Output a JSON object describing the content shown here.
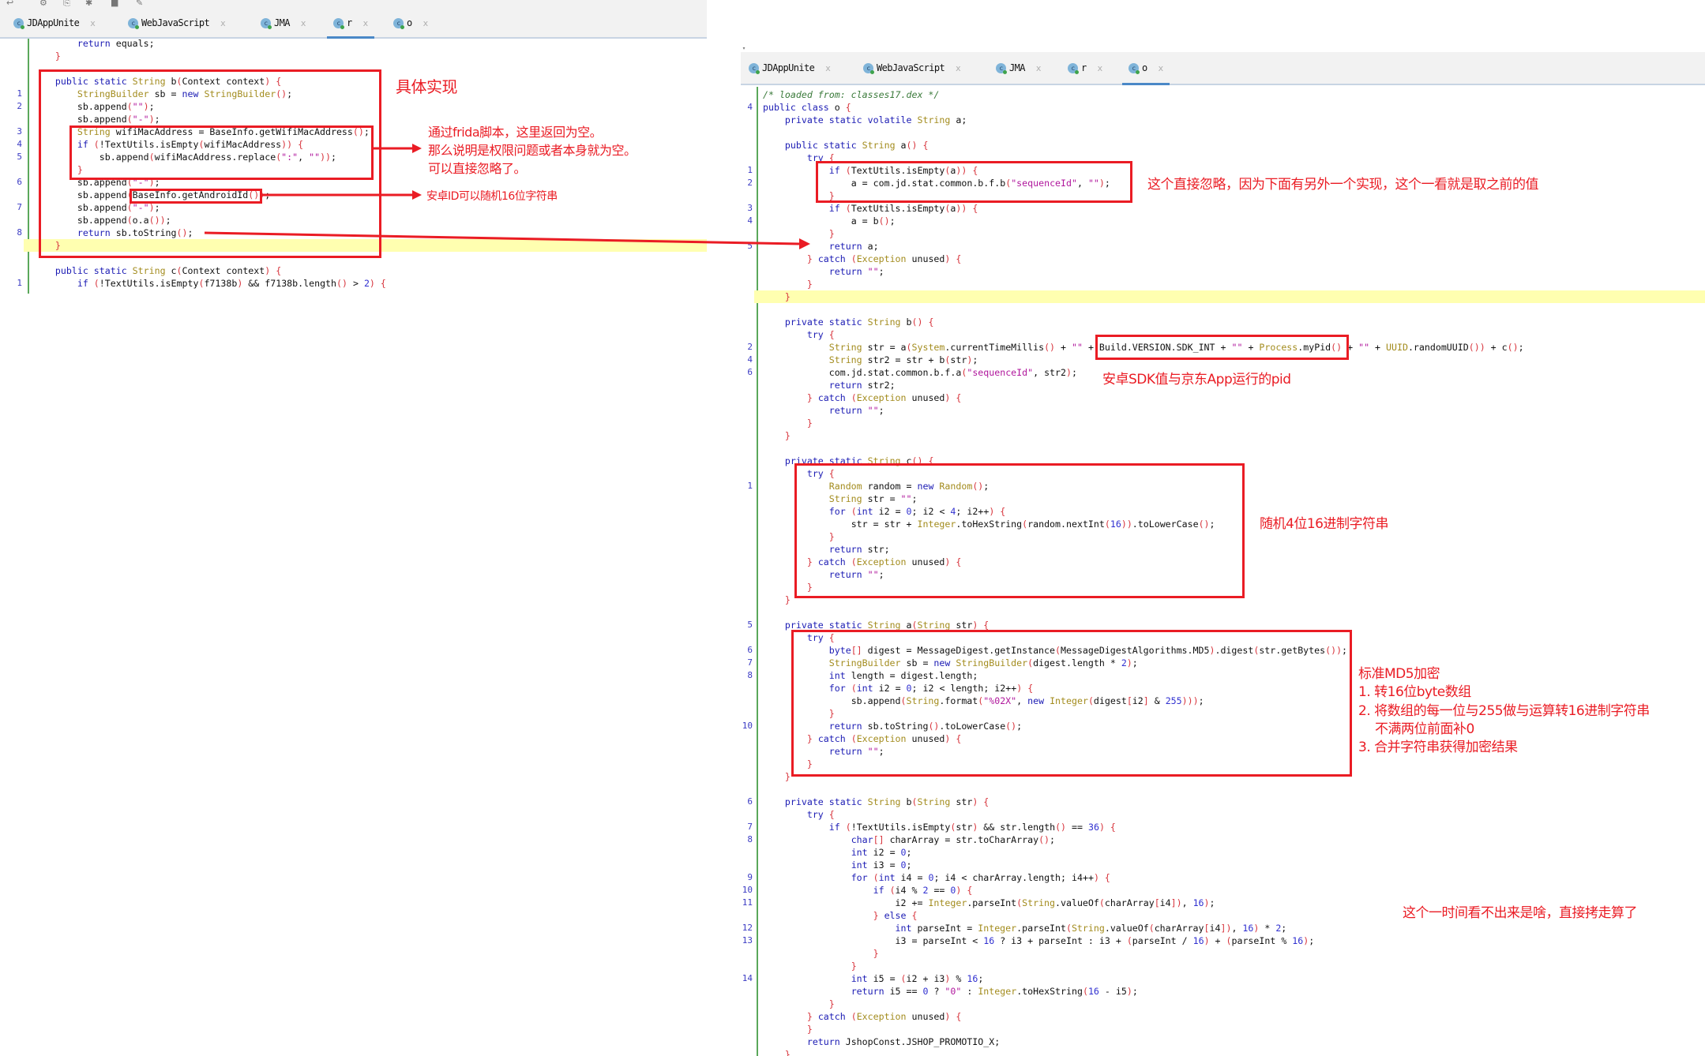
{
  "left_editor": {
    "tabs": [
      {
        "label": "JDAppUnite",
        "active": false
      },
      {
        "label": "WebJavaScript",
        "active": false
      },
      {
        "label": "JMA",
        "active": false
      },
      {
        "label": "r",
        "active": true
      },
      {
        "label": "o",
        "active": false
      }
    ],
    "tab_icon": "c",
    "close_glyph": "x",
    "highlighted_line": 16,
    "lines": [
      {
        "n": "",
        "t": "        return equals;"
      },
      {
        "n": "",
        "t": "    }"
      },
      {
        "n": "",
        "t": ""
      },
      {
        "n": "",
        "t": "    public static String b(Context context) {"
      },
      {
        "n": "1",
        "t": "        StringBuilder sb = new StringBuilder();"
      },
      {
        "n": "2",
        "t": "        sb.append(\"\");"
      },
      {
        "n": "",
        "t": "        sb.append(\"-\");"
      },
      {
        "n": "3",
        "t": "        String wifiMacAddress = BaseInfo.getWifiMacAddress();"
      },
      {
        "n": "4",
        "t": "        if (!TextUtils.isEmpty(wifiMacAddress)) {"
      },
      {
        "n": "5",
        "t": "            sb.append(wifiMacAddress.replace(\":\", \"\"));"
      },
      {
        "n": "",
        "t": "        }"
      },
      {
        "n": "6",
        "t": "        sb.append(\"-\");"
      },
      {
        "n": "",
        "t": "        sb.append(BaseInfo.getAndroidId());"
      },
      {
        "n": "7",
        "t": "        sb.append(\"-\");"
      },
      {
        "n": "",
        "t": "        sb.append(o.a());"
      },
      {
        "n": "8",
        "t": "        return sb.toString();"
      },
      {
        "n": "",
        "t": "    }"
      },
      {
        "n": "",
        "t": ""
      },
      {
        "n": "",
        "t": "    public static String c(Context context) {"
      },
      {
        "n": "1",
        "t": "        if (!TextUtils.isEmpty(f7138b) && f7138b.length() > 2) {"
      }
    ]
  },
  "right_editor": {
    "tabs": [
      {
        "label": "JDAppUnite",
        "active": false
      },
      {
        "label": "WebJavaScript",
        "active": false
      },
      {
        "label": "JMA",
        "active": false
      },
      {
        "label": "r",
        "active": false
      },
      {
        "label": "o",
        "active": true
      }
    ],
    "highlighted_line": 16,
    "lines": [
      {
        "n": "",
        "t": "/* loaded from: classes17.dex */"
      },
      {
        "n": "4",
        "t": "public class o {"
      },
      {
        "n": "",
        "t": "    private static volatile String a;"
      },
      {
        "n": "",
        "t": ""
      },
      {
        "n": "",
        "t": "    public static String a() {"
      },
      {
        "n": "",
        "t": "        try {"
      },
      {
        "n": "1",
        "t": "            if (TextUtils.isEmpty(a)) {"
      },
      {
        "n": "2",
        "t": "                a = com.jd.stat.common.b.f.b(\"sequenceId\", \"\");"
      },
      {
        "n": "",
        "t": "            }"
      },
      {
        "n": "3",
        "t": "            if (TextUtils.isEmpty(a)) {"
      },
      {
        "n": "4",
        "t": "                a = b();"
      },
      {
        "n": "",
        "t": "            }"
      },
      {
        "n": "5",
        "t": "            return a;"
      },
      {
        "n": "",
        "t": "        } catch (Exception unused) {"
      },
      {
        "n": "",
        "t": "            return \"\";"
      },
      {
        "n": "",
        "t": "        }"
      },
      {
        "n": "",
        "t": "    }"
      },
      {
        "n": "",
        "t": ""
      },
      {
        "n": "",
        "t": "    private static String b() {"
      },
      {
        "n": "",
        "t": "        try {"
      },
      {
        "n": "2",
        "t": "            String str = a(System.currentTimeMillis() + \"\" + Build.VERSION.SDK_INT + \"\" + Process.myPid() + \"\" + UUID.randomUUID()) + c();"
      },
      {
        "n": "4",
        "t": "            String str2 = str + b(str);"
      },
      {
        "n": "6",
        "t": "            com.jd.stat.common.b.f.a(\"sequenceId\", str2);"
      },
      {
        "n": "",
        "t": "            return str2;"
      },
      {
        "n": "",
        "t": "        } catch (Exception unused) {"
      },
      {
        "n": "",
        "t": "            return \"\";"
      },
      {
        "n": "",
        "t": "        }"
      },
      {
        "n": "",
        "t": "    }"
      },
      {
        "n": "",
        "t": ""
      },
      {
        "n": "",
        "t": "    private static String c() {"
      },
      {
        "n": "",
        "t": "        try {"
      },
      {
        "n": "1",
        "t": "            Random random = new Random();"
      },
      {
        "n": "",
        "t": "            String str = \"\";"
      },
      {
        "n": "",
        "t": "            for (int i2 = 0; i2 < 4; i2++) {"
      },
      {
        "n": "",
        "t": "                str = str + Integer.toHexString(random.nextInt(16)).toLowerCase();"
      },
      {
        "n": "",
        "t": "            }"
      },
      {
        "n": "",
        "t": "            return str;"
      },
      {
        "n": "",
        "t": "        } catch (Exception unused) {"
      },
      {
        "n": "",
        "t": "            return \"\";"
      },
      {
        "n": "",
        "t": "        }"
      },
      {
        "n": "",
        "t": "    }"
      },
      {
        "n": "",
        "t": ""
      },
      {
        "n": "5",
        "t": "    private static String a(String str) {"
      },
      {
        "n": "",
        "t": "        try {"
      },
      {
        "n": "6",
        "t": "            byte[] digest = MessageDigest.getInstance(MessageDigestAlgorithms.MD5).digest(str.getBytes());"
      },
      {
        "n": "7",
        "t": "            StringBuilder sb = new StringBuilder(digest.length * 2);"
      },
      {
        "n": "8",
        "t": "            int length = digest.length;"
      },
      {
        "n": "",
        "t": "            for (int i2 = 0; i2 < length; i2++) {"
      },
      {
        "n": "",
        "t": "                sb.append(String.format(\"%02X\", new Integer(digest[i2] & 255)));"
      },
      {
        "n": "",
        "t": "            }"
      },
      {
        "n": "10",
        "t": "            return sb.toString().toLowerCase();"
      },
      {
        "n": "",
        "t": "        } catch (Exception unused) {"
      },
      {
        "n": "",
        "t": "            return \"\";"
      },
      {
        "n": "",
        "t": "        }"
      },
      {
        "n": "",
        "t": "    }"
      },
      {
        "n": "",
        "t": ""
      },
      {
        "n": "6",
        "t": "    private static String b(String str) {"
      },
      {
        "n": "",
        "t": "        try {"
      },
      {
        "n": "7",
        "t": "            if (!TextUtils.isEmpty(str) && str.length() == 36) {"
      },
      {
        "n": "8",
        "t": "                char[] charArray = str.toCharArray();"
      },
      {
        "n": "",
        "t": "                int i2 = 0;"
      },
      {
        "n": "",
        "t": "                int i3 = 0;"
      },
      {
        "n": "9",
        "t": "                for (int i4 = 0; i4 < charArray.length; i4++) {"
      },
      {
        "n": "10",
        "t": "                    if (i4 % 2 == 0) {"
      },
      {
        "n": "11",
        "t": "                        i2 += Integer.parseInt(String.valueOf(charArray[i4]), 16);"
      },
      {
        "n": "",
        "t": "                    } else {"
      },
      {
        "n": "12",
        "t": "                        int parseInt = Integer.parseInt(String.valueOf(charArray[i4]), 16) * 2;"
      },
      {
        "n": "13",
        "t": "                        i3 = parseInt < 16 ? i3 + parseInt : i3 + (parseInt / 16) + (parseInt % 16);"
      },
      {
        "n": "",
        "t": "                    }"
      },
      {
        "n": "",
        "t": "                }"
      },
      {
        "n": "14",
        "t": "                int i5 = (i2 + i3) % 16;"
      },
      {
        "n": "",
        "t": "                return i5 == 0 ? \"0\" : Integer.toHexString(16 - i5);"
      },
      {
        "n": "",
        "t": "            }"
      },
      {
        "n": "",
        "t": "        } catch (Exception unused) {"
      },
      {
        "n": "",
        "t": "        }"
      },
      {
        "n": "",
        "t": "        return JshopConst.JSHOP_PROMOTIO_X;"
      },
      {
        "n": "",
        "t": "    }"
      }
    ]
  },
  "annotations": {
    "impl": "具体实现",
    "wifi": [
      "通过frida脚本，这里返回为空。",
      "那么说明是权限问题或者本身就为空。",
      "可以直接忽略了。"
    ],
    "android_id": "安卓ID可以随机16位字符串",
    "ignore": "这个直接忽略，因为下面有另外一个实现，这个一看就是取之前的值",
    "sdk_pid": "安卓SDK值与京东App运行的pid",
    "random_hex": "随机4位16进制字符串",
    "md5": [
      "标准MD5加密",
      "1. 转16位byte数组",
      "2. 将数组的每一位与255做与运算转16进制字符串",
      "不满两位前面补0",
      "3. 合并字符串获得加密结果"
    ],
    "unknown": "这个一时间看不出来是啥，直接拷走算了"
  },
  "colors": {
    "annotation": "#ea1c24",
    "highlight": "#ffffb0",
    "tab_active": "#4a88c7"
  }
}
